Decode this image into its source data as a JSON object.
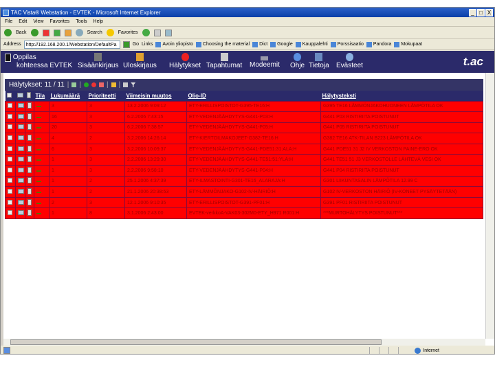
{
  "window": {
    "title": "TAC Vista® Webstation - EVTEK - Microsoft Internet Explorer",
    "controls": [
      "_",
      "□",
      "X"
    ]
  },
  "menu": [
    "File",
    "Edit",
    "View",
    "Favorites",
    "Tools",
    "Help"
  ],
  "toolbar": {
    "back": "Back",
    "search": "Search",
    "favorites": "Favorites"
  },
  "address": {
    "label": "Address",
    "value": "http://192.168.200.1/Webstation/DefaultPa",
    "go": "Go",
    "links_label": "Links",
    "links": [
      "Avoin yliopisto",
      "Choosing the material",
      "Dict",
      "Google",
      "Kauppalehti",
      "Porssisaatio",
      "Pandora",
      "Mokupaat"
    ]
  },
  "nav": {
    "user_line1": "Oppilas",
    "user_line2": "kohteessa EVTEK",
    "items": [
      {
        "label": "Sisäänkirjaus",
        "icon": "login-icon"
      },
      {
        "label": "Uloskirjaus",
        "icon": "logout-icon"
      },
      {
        "label": "Hälytykset",
        "icon": "alarm-icon"
      },
      {
        "label": "Tapahtumat",
        "icon": "events-icon"
      },
      {
        "label": "Modeemit",
        "icon": "modem-icon"
      },
      {
        "label": "Ohje",
        "icon": "help-icon"
      },
      {
        "label": "Tietoja",
        "icon": "info-people-icon"
      },
      {
        "label": "Evästeet",
        "icon": "cookie-info-icon"
      }
    ],
    "logo": "t.a.c"
  },
  "panel": {
    "title": "Hälytykset: 11 / 11"
  },
  "table": {
    "headers": [
      "Tila",
      "Lukumäärä",
      "Prioriteetti",
      "Viimeisin muutos",
      "Olio-ID",
      "Hälytysteksti"
    ],
    "rows": [
      [
        "3",
        "3",
        "13.2.2006 9:09:12",
        "ETY-ERILLISPOISTOT-G395-TE16:H",
        "G395 TE16 LÄMMÖNJAKOHUONEEN LÄMPÖTILA OK"
      ],
      [
        "16",
        "3",
        "6.2.2006 7:43:15",
        "ETY-VEDENJÄÄHDYTYS-G441-P03:H",
        "G441 P03 RISTIRIITA POISTUNUT"
      ],
      [
        "20",
        "3",
        "6.2.2006 7:38:57",
        "ETY-VEDENJÄÄHDYTYS-G441-P05:H",
        "G441 P05 RISTIRIITA POISTUNUT"
      ],
      [
        "4",
        "2",
        "3.2.2006 14:26:14",
        "ETY-KIERTOILMAKOJEET-G382-TE16:H",
        "G382 TE16 ATK-TILAN B223 LÄMPÖTILA OK"
      ],
      [
        "6",
        "3",
        "3.2.2006 10:09:37",
        "ETY-VEDENJÄÄHDYTYS-G441-PDE51:31:ALA:H",
        "G441 PDE51 31 J2 IV VERKOSTON PAINE-ERO OK"
      ],
      [
        "1",
        "3",
        "2.2.2006 13:29:30",
        "ETY-VEDENJÄÄHDYTYS-G441-TE51:51:YLÄ:H",
        "G441 TE51 51 J3 VERKOSTOLLE LÄHTEVÄ VESI OK"
      ],
      [
        "1",
        "3",
        "2.2.2006 9:58:10",
        "ETY-VEDENJÄÄHDYTYS-G441-P04:H",
        "G441 P04 RISTIRIITA POISTUNUT"
      ],
      [
        "1",
        "2",
        "25.1.2006 4:37:39",
        "ETY-ILMASTOINTI-G301-TE16_ALARAJA:H",
        "G301 LIIKUNTASALIN LÄMPÖTILA 12.99 C"
      ],
      [
        "1",
        "2",
        "21.1.2006 20:38:53",
        "ETY-LÄMMÖNJAKO-G102-IV-HÄIRIÖ:H",
        "G102 IV-VERKOSTON HÄIRIÖ (IV-KONEET PYSÄYTETÄÄN)"
      ],
      [
        "2",
        "3",
        "12.1.2006 9:10:35",
        "ETY-ERILLISPOISTOT-G391-PF01:H",
        "G391 PF01 RISTIRIITA POISTUNUT"
      ],
      [
        "1",
        "8",
        "3.1.2006 2:43:00",
        "EVTEK-verkkoA-VAK03-302M0-ETY_H971 R001:H",
        "***MURTOHÄLYTYS POISTUNUT***"
      ]
    ]
  },
  "status": {
    "zone": "Internet"
  },
  "colors": {
    "row_bg": "#ff0000",
    "header_bg": "#2b2a6a",
    "nav_bg": "#2b2a6a"
  }
}
